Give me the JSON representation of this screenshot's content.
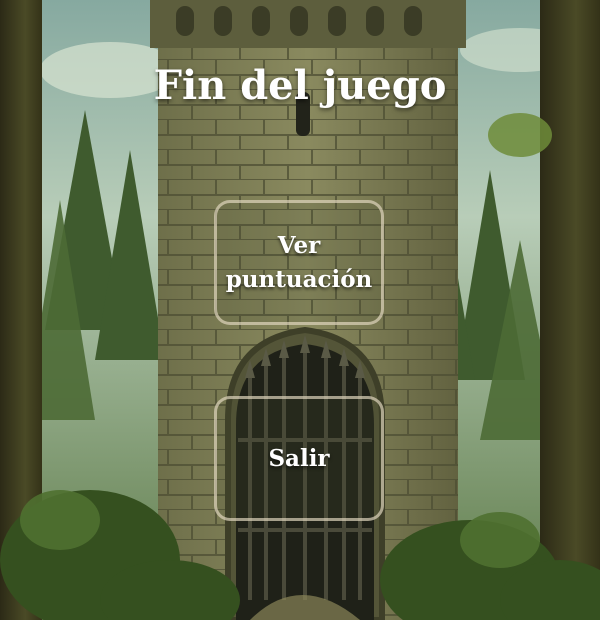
{
  "game": {
    "title": "Fin del juego",
    "buttons": {
      "score_label": "Ver puntuación",
      "exit_label": "Salir"
    }
  }
}
